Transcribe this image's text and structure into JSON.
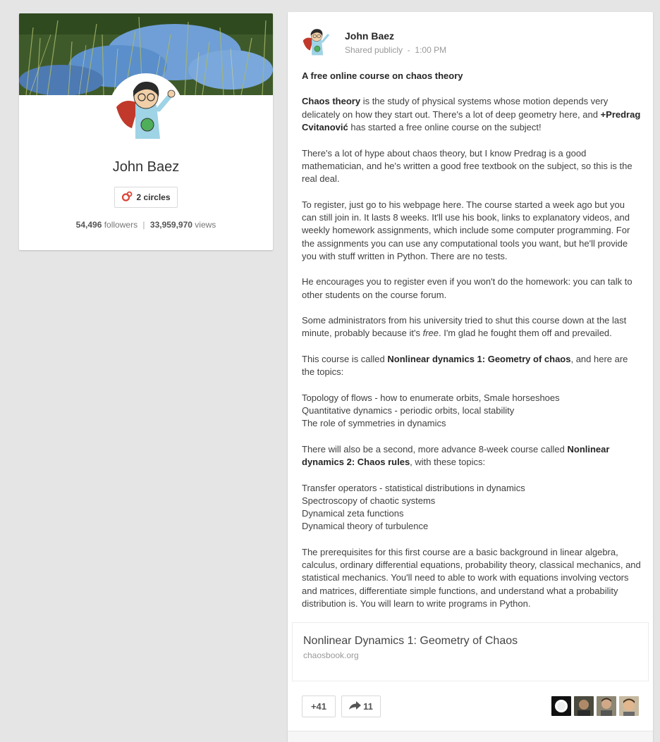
{
  "profile": {
    "name": "John Baez",
    "circles_label": "2 circles",
    "followers_count": "54,496",
    "followers_label": "followers",
    "views_count": "33,959,970",
    "views_label": "views"
  },
  "post": {
    "author": "John Baez",
    "visibility": "Shared publicly",
    "separator": "-",
    "time": "1:00 PM",
    "title": "A free online course on chaos theory",
    "p1_bold": "Chaos theory",
    "p1_a": " is the study of physical systems whose motion depends very delicately on how they start out.  There's a lot of deep geometry here, and ",
    "p1_mention": "+Predrag Cvitanović",
    "p1_b": " has started a free online course on the subject!",
    "p2": "There's a lot of hype about chaos theory, but I know Predrag is a good mathematician, and he's written a good free textbook on the subject, so this is the real deal.",
    "p3": "To register, just go to his webpage here.  The course started a week ago but you can still join in.  It lasts 8 weeks.  It'll use his book, links to explanatory videos, and weekly homework assignments, which include some computer programming.  For the assignments you can use any computational tools you want, but he'll provide you with stuff written in Python.  There are no tests.",
    "p4": "He encourages you to register even if you won't do the homework: you can talk to other students on the course forum.",
    "p5_a": "Some administrators from his university tried to shut this course down at the last minute, probably because it's ",
    "p5_em": "free",
    "p5_b": ".  I'm glad he fought them off and prevailed.",
    "p6_a": "This course is called ",
    "p6_bold": "Nonlinear dynamics 1: Geometry of chaos",
    "p6_b": ", and here are the topics:",
    "topics1": [
      "Topology of flows - how to enumerate orbits, Smale horseshoes",
      "Quantitative dynamics - periodic orbits, local stability",
      "The role of symmetries in dynamics"
    ],
    "p7_a": "There will also be a second, more advance 8-week course called ",
    "p7_bold": "Nonlinear dynamics 2: Chaos rules",
    "p7_b": ", with these topics:",
    "topics2": [
      "Transfer operators - statistical distributions in dynamics",
      "Spectroscopy of chaotic systems",
      "Dynamical zeta functions",
      "Dynamical theory of turbulence"
    ],
    "p8": "The prerequisites for this first course are a basic background in linear algebra, calculus, ordinary differential equations, probability theory, classical mechanics, and statistical mechanics.  You'll need to able to work with equations involving vectors and matrices, differentiate simple functions, and understand what a probability distribution is.   You will learn to write programs in Python.",
    "link_title": "Nonlinear Dynamics 1: Geometry of Chaos",
    "link_domain": "chaosbook.org",
    "plus_label": "+41",
    "share_count": "11"
  },
  "colors": {
    "background": "#e5e5e5",
    "card": "#ffffff",
    "circles_icon": "#db4437",
    "text": "#404040",
    "muted": "#999999"
  }
}
